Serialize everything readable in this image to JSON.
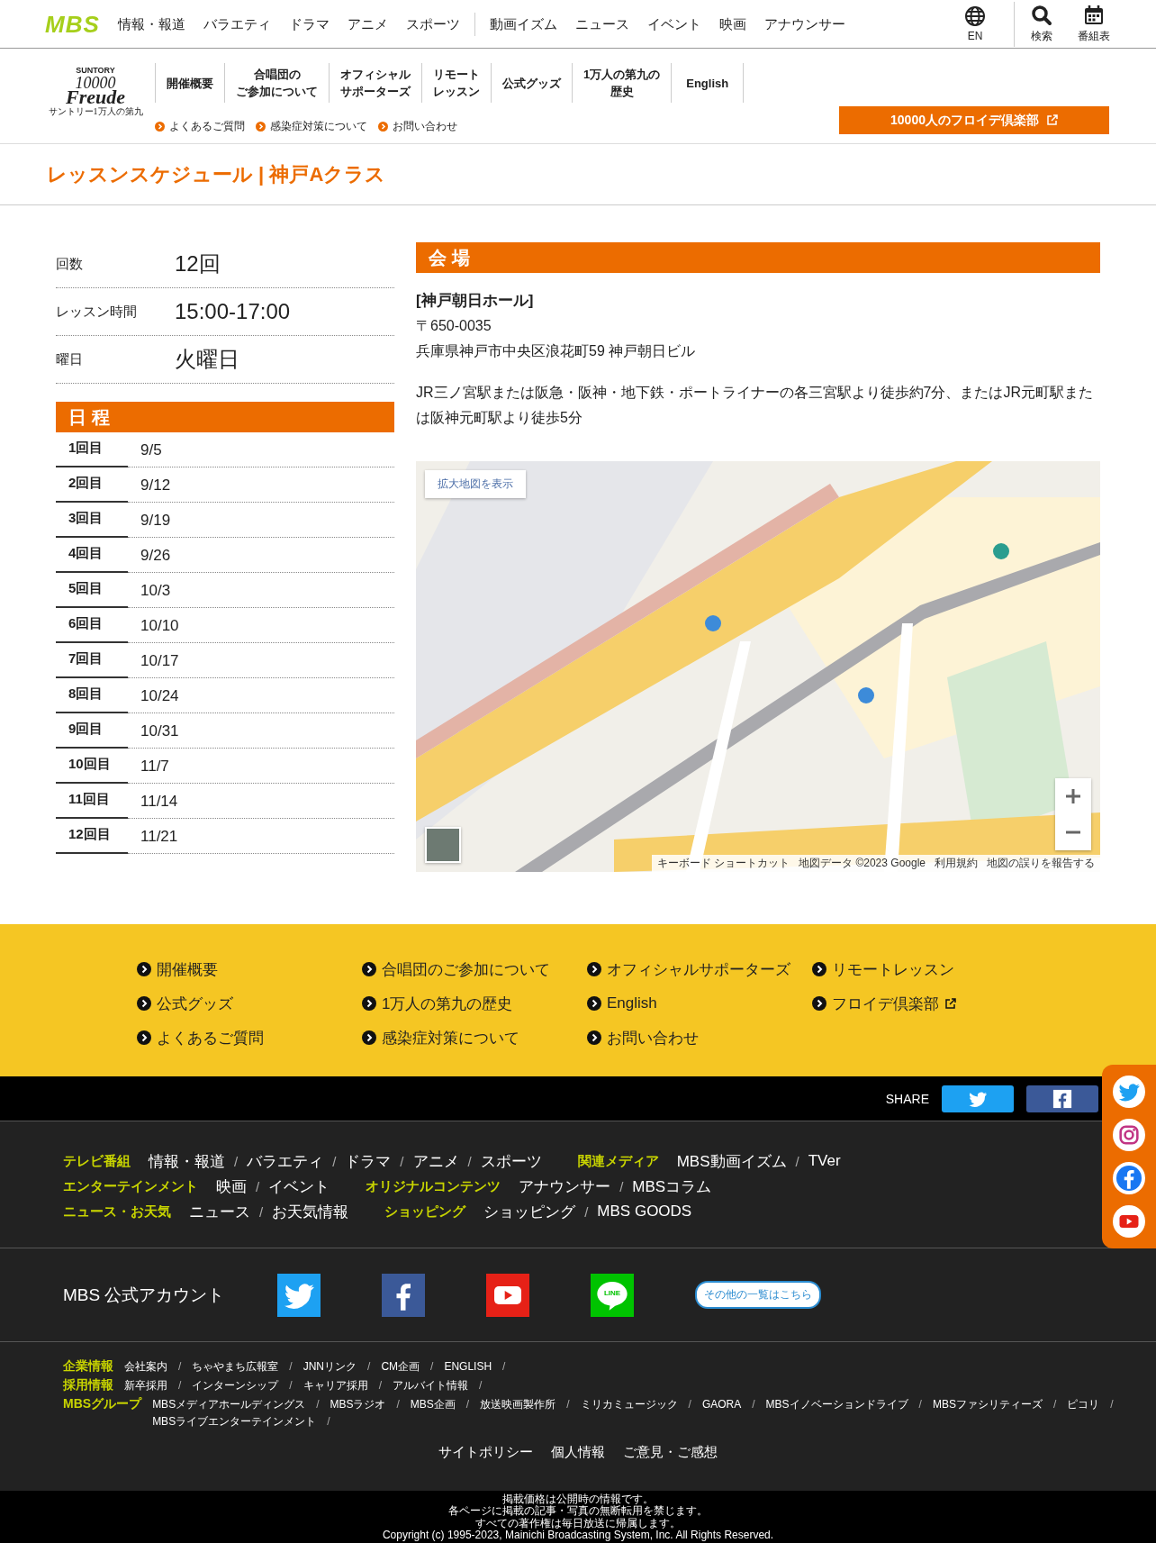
{
  "header": {
    "logo": "MBS",
    "nav_groups": [
      [
        "情報・報道",
        "バラエティ",
        "ドラマ",
        "アニメ",
        "スポーツ"
      ],
      [
        "動画イズム",
        "ニュース",
        "イベント",
        "映画",
        "アナウンサー"
      ]
    ],
    "utilities": [
      {
        "kind": "language",
        "label": "EN"
      },
      {
        "kind": "search",
        "label": "検索"
      },
      {
        "kind": "schedule",
        "label": "番組表"
      }
    ]
  },
  "subnav": {
    "logo": {
      "brand": "SUNTORY",
      "number": "10000",
      "word": "Freude",
      "caption": "サントリー1万人の第九"
    },
    "items": [
      [
        "開催概要"
      ],
      [
        "合唱団の",
        "ご参加について"
      ],
      [
        "オフィシャル",
        "サポーターズ"
      ],
      [
        "リモート",
        "レッスン"
      ],
      [
        "公式グッズ"
      ],
      [
        "1万人の第九の",
        "歴史"
      ],
      [
        "English"
      ]
    ],
    "sublinks": [
      "よくあるご質問",
      "感染症対策について",
      "お問い合わせ"
    ],
    "cta": {
      "label": "10000人のフロイデ倶楽部",
      "external": true
    }
  },
  "page_title": "レッスンスケジュール | 神戸Aクラス",
  "info": [
    {
      "label": "回数",
      "value": "12回"
    },
    {
      "label": "レッスン時間",
      "value": "15:00-17:00"
    },
    {
      "label": "曜日",
      "value": "火曜日"
    }
  ],
  "schedule": {
    "heading": "日 程",
    "rows": [
      {
        "label": "1回目",
        "date": "9/5"
      },
      {
        "label": "2回目",
        "date": "9/12"
      },
      {
        "label": "3回目",
        "date": "9/19"
      },
      {
        "label": "4回目",
        "date": "9/26"
      },
      {
        "label": "5回目",
        "date": "10/3"
      },
      {
        "label": "6回目",
        "date": "10/10"
      },
      {
        "label": "7回目",
        "date": "10/17"
      },
      {
        "label": "8回目",
        "date": "10/24"
      },
      {
        "label": "9回目",
        "date": "10/31"
      },
      {
        "label": "10回目",
        "date": "11/7"
      },
      {
        "label": "11回目",
        "date": "11/14"
      },
      {
        "label": "12回目",
        "date": "11/21"
      }
    ]
  },
  "venue": {
    "heading": "会 場",
    "name": "[神戸朝日ホール]",
    "postal": "〒650-0035",
    "address": "兵庫県神戸市中央区浪花町59 神戸朝日ビル",
    "access": "JR三ノ宮駅または阪急・阪神・地下鉄・ポートライナーの各三宮駅より徒歩約7分、またはJR元町駅または阪神元町駅より徒歩5分",
    "map": {
      "kind": "picture",
      "button": "拡大地図を表示",
      "attribution": [
        "キーボード ショートカット",
        "地図データ ©2023 Google",
        "利用規約",
        "地図の誤りを報告する"
      ]
    }
  },
  "footer_links": [
    {
      "label": "開催概要",
      "external": false
    },
    {
      "label": "合唱団のご参加について",
      "external": false
    },
    {
      "label": "オフィシャルサポーターズ",
      "external": false
    },
    {
      "label": "リモートレッスン",
      "external": false
    },
    {
      "label": "公式グッズ",
      "external": false
    },
    {
      "label": "1万人の第九の歴史",
      "external": false
    },
    {
      "label": "English",
      "external": false
    },
    {
      "label": "フロイデ倶楽部",
      "external": true
    },
    {
      "label": "よくあるご質問",
      "external": false
    },
    {
      "label": "感染症対策について",
      "external": false
    },
    {
      "label": "お問い合わせ",
      "external": false
    }
  ],
  "share": {
    "label": "SHARE",
    "buttons": [
      {
        "kind": "twitter"
      },
      {
        "kind": "facebook"
      }
    ]
  },
  "tv_nav": [
    [
      {
        "title": "テレビ番組",
        "links": [
          {
            "label": "情報・報道",
            "sep": "/"
          },
          {
            "label": "バラエティ",
            "sep": "/"
          },
          {
            "label": "ドラマ",
            "sep": "/"
          },
          {
            "label": "アニメ",
            "sep": "/"
          },
          {
            "label": "スポーツ"
          }
        ]
      },
      {
        "title": "関連メディア",
        "links": [
          {
            "label": "MBS動画イズム",
            "sep": "/"
          },
          {
            "label": "TVer"
          }
        ]
      }
    ],
    [
      {
        "title": "エンターテインメント",
        "links": [
          {
            "label": "映画",
            "sep": "/"
          },
          {
            "label": "イベント"
          }
        ]
      },
      {
        "title": "オリジナルコンテンツ",
        "links": [
          {
            "label": "アナウンサー",
            "sep": "/"
          },
          {
            "label": "MBSコラム"
          }
        ]
      }
    ],
    [
      {
        "title": "ニュース・お天気",
        "links": [
          {
            "label": "ニュース",
            "sep": "/"
          },
          {
            "label": "お天気情報"
          }
        ]
      },
      {
        "title": "ショッピング",
        "links": [
          {
            "label": "ショッピング",
            "sep": "/"
          },
          {
            "label": "MBS GOODS"
          }
        ]
      }
    ]
  ],
  "accounts": {
    "label": "MBS 公式アカウント",
    "icons": [
      {
        "kind": "twitter"
      },
      {
        "kind": "facebook"
      },
      {
        "kind": "youtube"
      },
      {
        "kind": "line",
        "text": "LINE"
      }
    ],
    "more": "その他の一覧はこちら"
  },
  "corporate": [
    {
      "title": "企業情報",
      "links": [
        {
          "label": "会社案内",
          "sep": "/"
        },
        {
          "label": "ちゃやまち広報室",
          "sep": "/"
        },
        {
          "label": "JNNリンク",
          "sep": "/"
        },
        {
          "label": "CM企画",
          "sep": "/"
        },
        {
          "label": "ENGLISH",
          "sep": "/"
        }
      ]
    },
    {
      "title": "採用情報",
      "links": [
        {
          "label": "新卒採用",
          "sep": "/"
        },
        {
          "label": "インターンシップ",
          "sep": "/"
        },
        {
          "label": "キャリア採用",
          "sep": "/"
        },
        {
          "label": "アルバイト情報",
          "sep": "/"
        }
      ]
    },
    {
      "title": "MBSグループ",
      "links": [
        {
          "label": "MBSメディアホールディングス",
          "sep": "/"
        },
        {
          "label": "MBSラジオ",
          "sep": "/"
        },
        {
          "label": "MBS企画",
          "sep": "/"
        },
        {
          "label": "放送映画製作所",
          "sep": "/"
        },
        {
          "label": "ミリカミュージック",
          "sep": "/"
        },
        {
          "label": "GAORA",
          "sep": "/"
        },
        {
          "label": "MBSイノベーションドライブ",
          "sep": "/"
        },
        {
          "label": "MBSファシリティーズ",
          "sep": "/"
        },
        {
          "label": "ピコリ",
          "sep": "/"
        },
        {
          "label": "MBSライブエンターテインメント",
          "sep": "/"
        }
      ]
    }
  ],
  "policy_links": [
    "サイトポリシー",
    "個人情報",
    "ご意見・ご感想"
  ],
  "copyright": [
    "掲載価格は公開時の情報です。",
    "各ページに掲載の記事・写真の無断転用を禁じます。",
    "すべての著作権は毎日放送に帰属します。",
    "Copyright (c) 1995-2023, Mainichi Broadcasting System, Inc. All Rights Reserved."
  ],
  "side_social": [
    {
      "kind": "twitter"
    },
    {
      "kind": "instagram"
    },
    {
      "kind": "facebook"
    },
    {
      "kind": "youtube"
    }
  ]
}
